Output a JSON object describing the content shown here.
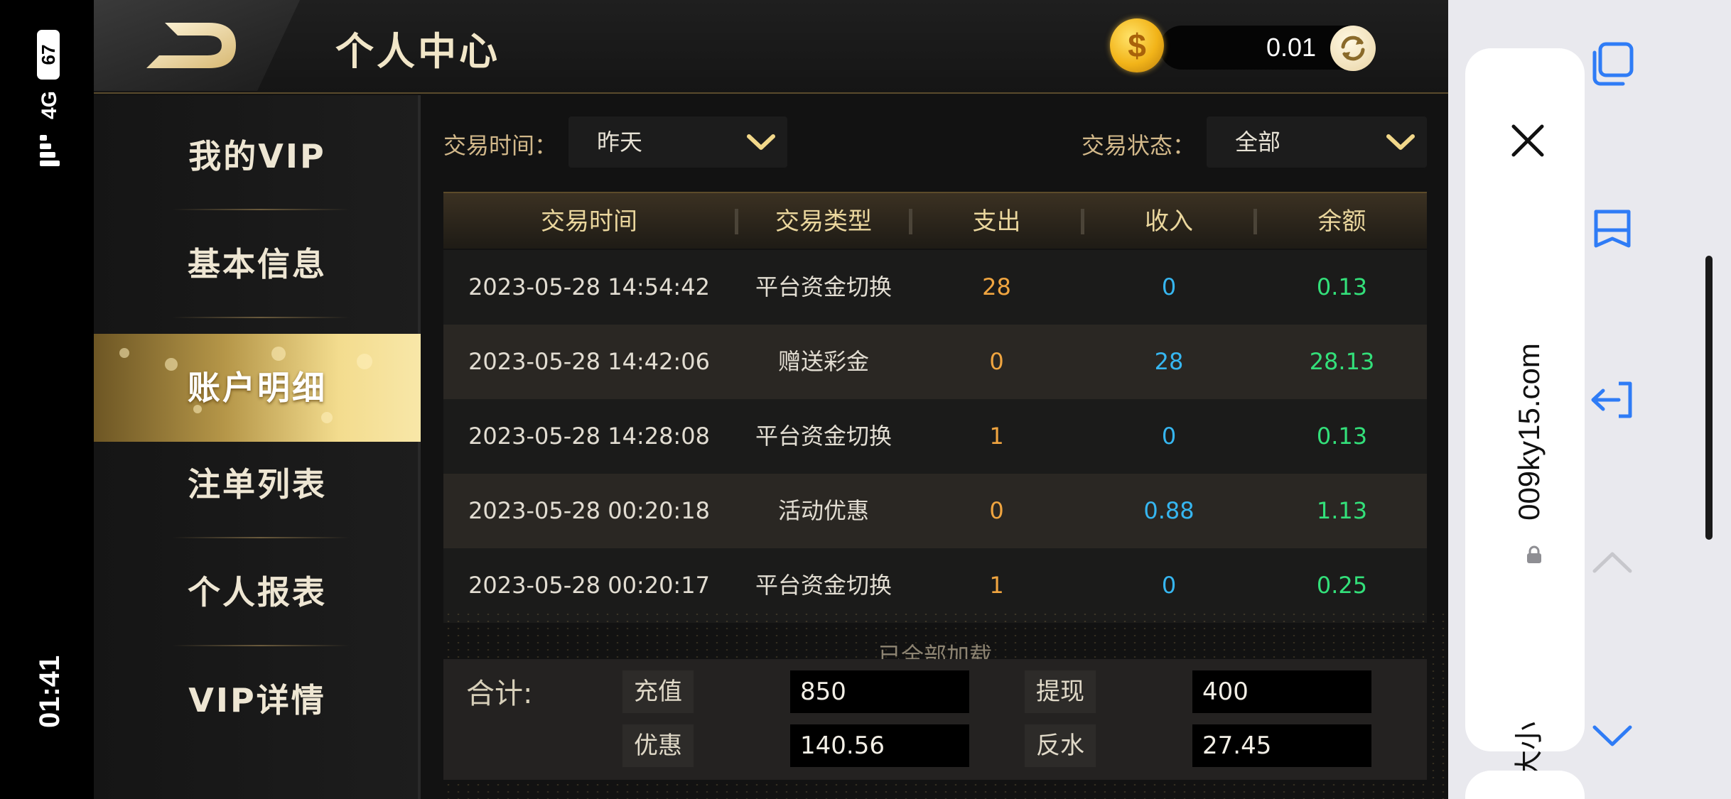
{
  "status_bar": {
    "time": "01:41",
    "network": "4G",
    "battery": "67"
  },
  "header": {
    "title": "个人中心",
    "balance": "0.01"
  },
  "sidebar": {
    "items": [
      {
        "label": "我的VIP"
      },
      {
        "label": "基本信息"
      },
      {
        "label": "账户明细"
      },
      {
        "label": "注单列表"
      },
      {
        "label": "个人报表"
      },
      {
        "label": "VIP详情"
      }
    ],
    "active_index": 2
  },
  "filters": {
    "time_label": "交易时间：",
    "time_value": "昨天",
    "status_label": "交易状态：",
    "status_value": "全部"
  },
  "table": {
    "headers": [
      "交易时间",
      "交易类型",
      "支出",
      "收入",
      "余额"
    ],
    "rows": [
      {
        "time": "2023-05-28 14:54:42",
        "type": "平台资金切换",
        "out": "28",
        "in": "0",
        "balance": "0.13"
      },
      {
        "time": "2023-05-28 14:42:06",
        "type": "赠送彩金",
        "out": "0",
        "in": "28",
        "balance": "28.13"
      },
      {
        "time": "2023-05-28 14:28:08",
        "type": "平台资金切换",
        "out": "1",
        "in": "0",
        "balance": "0.13"
      },
      {
        "time": "2023-05-28 00:20:18",
        "type": "活动优惠",
        "out": "0",
        "in": "0.88",
        "balance": "1.13"
      },
      {
        "time": "2023-05-28 00:20:17",
        "type": "平台资金切换",
        "out": "1",
        "in": "0",
        "balance": "0.25"
      }
    ],
    "footer_note": "已全部加载"
  },
  "summary": {
    "label": "合计:",
    "recharge_label": "充值",
    "recharge_value": "850",
    "withdraw_label": "提现",
    "withdraw_value": "400",
    "discount_label": "优惠",
    "discount_value": "140.56",
    "rebate_label": "反水",
    "rebate_value": "27.45"
  },
  "browser": {
    "url": "009ky15.com",
    "text_size_label": "大小"
  },
  "colors": {
    "accent_gold": "#ead69d",
    "expense": "#f0a540",
    "income": "#36b6f0",
    "balance": "#33e07a",
    "ios_blue": "#2f7cf6"
  },
  "icons": [
    "back-arrow-icon",
    "coin-icon",
    "refresh-icon",
    "chevron-down-icon",
    "close-icon",
    "lock-icon",
    "tabs-icon",
    "bookmarks-icon",
    "share-icon",
    "chevron-up-icon"
  ]
}
